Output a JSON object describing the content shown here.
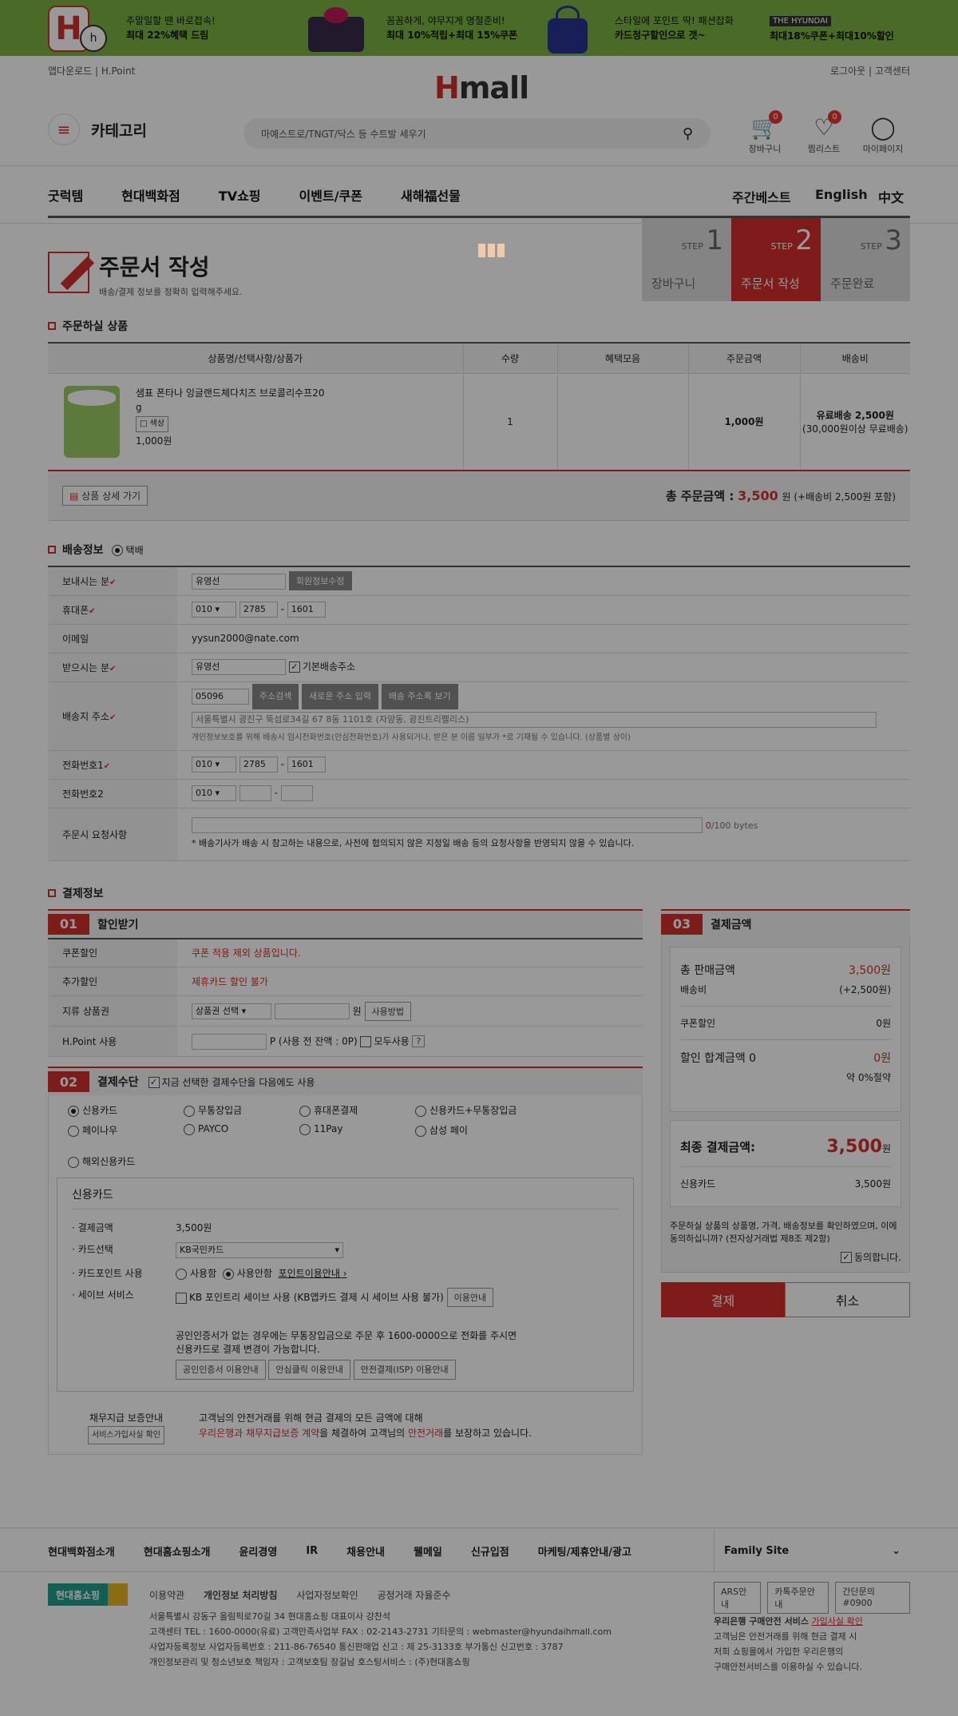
{
  "banner": [
    {
      "line1": "주말일할 땐 바로접속!",
      "line2": "최대 22%혜택 드림"
    },
    {
      "line1": "꼼꼼하게, 야무지게 명절준비!",
      "line2": "최대 10%적립+최대 15%쿠폰"
    },
    {
      "line1": "스타일에 포인트 딱! 패션잡화",
      "line2": "카드청구할인으로 갯~"
    },
    {
      "brand": "THE HYUNDAI",
      "line2": "최대18%쿠폰+최대10%할인"
    }
  ],
  "header": {
    "left_links": "앱다운로드 | H.Point",
    "right_links": "로그아웃 | 고객센터",
    "logo_h": "H",
    "logo_rest": "mall",
    "category": "카테고리",
    "search_placeholder": "마예스트로/TNGT/닥스 등 수트발 세우기",
    "cart": "장바구니",
    "cart_count": "0",
    "wish": "찜리스트",
    "wish_count": "0",
    "mypage": "마이페이지"
  },
  "gnb": {
    "items": [
      "굿럭템",
      "현대백화점",
      "TV쇼핑",
      "이벤트/쿠폰",
      "새해福선물"
    ],
    "right": [
      "주간베스트",
      "English",
      "中文"
    ]
  },
  "title": {
    "main": "주문서 작성",
    "sub": "배송/결제 정보를 정확히 입력해주세요.",
    "steps": [
      {
        "label": "장바구니",
        "n": "1"
      },
      {
        "label": "주문서 작성",
        "n": "2"
      },
      {
        "label": "주문완료",
        "n": "3"
      }
    ],
    "step_prefix": "STEP"
  },
  "products": {
    "section": "주문하실 상품",
    "headers": [
      "상품명/선택사항/상품가",
      "수량",
      "혜택모음",
      "주문금액",
      "배송비"
    ],
    "item": {
      "name": "샘표 폰타나 잉글랜드체다치즈 브로콜리수프20",
      "name2": "g",
      "option": "□ 색상",
      "price": "1,000원",
      "qty": "1",
      "amount": "1,000원",
      "ship1": "유료배송 2,500원",
      "ship2": "(30,000원이상 무료배송)"
    },
    "detail_btn": "상품 상세 가기",
    "total_label": "총 주문금액 :",
    "total_value": "3,500",
    "total_unit": "원 (+배송비 2,500원 포함)"
  },
  "delivery": {
    "section": "배송정보",
    "radio": "택배",
    "sender_label": "보내시는 분",
    "sender": "유영선",
    "sender_btn": "회원정보수정",
    "mobile_label": "휴대폰",
    "mobile": [
      "010",
      "2785",
      "1601"
    ],
    "email_label": "이메일",
    "email": "yysun2000@nate.com",
    "receiver_label": "받으시는 분",
    "receiver": "유영선",
    "default_addr": "기본배송주소",
    "addr_label": "배송지 주소",
    "zip": "05096",
    "btn_search": "주소검색",
    "btn_new": "새로운 주소 입력",
    "btn_list": "배송 주소록 보기",
    "addr": "서울특별시 광진구 뚝섬로34길 67 8동 1101호 (자양동, 광진트리펠리스)",
    "addr_note": "개인정보보호를 위해 배송시 임시전화번호(안심전화번호)가 사용되거나, 받은 분 이름 일부가 *로 기재될 수 있습니다. (상품별 상이)",
    "tel1_label": "전화번호1",
    "tel1": [
      "010",
      "2785",
      "1601"
    ],
    "tel2_label": "전화번호2",
    "tel2": [
      "010",
      "",
      ""
    ],
    "req_label": "주문시 요청사항",
    "req_bytes": "0",
    "req_max": "/100 bytes",
    "req_note": "* 배송기사가 배송 시 참고하는 내용으로, 사전에 협의되지 않은 지정일 배송 등의 요청사항을 반영되지 않을 수 있습니다."
  },
  "payment": {
    "section": "결제정보",
    "discount": {
      "num": "01",
      "title": "할인받기",
      "coupon_label": "쿠폰할인",
      "coupon": "쿠폰 적용 제외 상품입니다.",
      "extra_label": "추가할인",
      "extra": "제휴카드 할인 불가",
      "gift_label": "지류 상품권",
      "gift_select": "상품권 선택",
      "gift_unit": "원",
      "gift_btn": "사용방법",
      "hpoint_label": "H.Point 사용",
      "hpoint_unit": "P",
      "hpoint_avail": "(사용 전 잔액 : 0P)",
      "hpoint_all": "모두사용",
      "hpoint_q": "?"
    },
    "method": {
      "num": "02",
      "title": "결제수단",
      "save_chk": "지금 선택한 결제수단을 다음에도 사용",
      "options": [
        "신용카드",
        "무통장입금",
        "휴대폰결제",
        "신용카드+무통장입금",
        "페이나우",
        "PAYCO",
        "11Pay",
        "삼성 페이"
      ],
      "overseas": "해외신용카드"
    },
    "card": {
      "title": "신용카드",
      "amount_label": "결제금액",
      "amount": "3,500원",
      "select_label": "카드선택",
      "select": "KB국민카드",
      "point_label": "카드포인트 사용",
      "point_use": "사용함",
      "point_nouse": "사용안함",
      "point_link": "포인트이용안내 ›",
      "save_label": "세이브 서비스",
      "save": "KB 포인트리 세이브 사용 (KB앱카드 결제 시 세이브 사용 불가)",
      "save_btn": "이용안내",
      "note1": "공인인증서가 없는 경우에는 무통장입금으로 주문 후 1600-0000으로 전화를 주시면",
      "note2": "신용카드로 결제 변경이 가능합니다.",
      "btns": [
        "공인인증서 이용안내",
        "안심클릭 이용안내",
        "안전결제(ISP) 이용안내"
      ]
    },
    "escrow": {
      "title": "채무지급 보증안내",
      "btn": "서비스가입사실 확인",
      "line1": "고객님의 안전거래를 위해 현금 결제의 모든 금액에 대해",
      "line2a": "우리은행과 채무지급보증 계약",
      "line2b": "을 체결하여 고객님의 ",
      "line2c": "안전거래",
      "line2d": "를 보장하고 있습니다."
    },
    "summary": {
      "num": "03",
      "title": "결제금액",
      "sale_label": "총 판매금액",
      "sale": "3,500원",
      "ship_label": "배송비",
      "ship": "(+2,500원)",
      "coupon_label": "쿠폰할인",
      "coupon": "0원",
      "disc_label": "할인 합계금액 0",
      "disc": "0원",
      "disc_pct": "약 0%절약",
      "final_label": "최종 결제금액:",
      "final": "3,500",
      "final_unit": "원",
      "card_label": "신용카드",
      "card": "3,500원",
      "agree_text": "주문하실 상품의 상품명, 가격, 배송정보를 확인하였으며, 이에동의하십니까? (전자상거래법 제8조 제2항)",
      "agree": "동의합니다.",
      "pay_btn": "결제",
      "cancel_btn": "취소"
    }
  },
  "footer": {
    "links": [
      "현대백화점소개",
      "현대홈쇼핑소개",
      "윤리경영",
      "IR",
      "채용안내",
      "웰메일",
      "신규입점",
      "마케팅/제휴안내/광고"
    ],
    "family": "Family Site",
    "logo": "현대홈쇼핑",
    "sublinks": [
      "이용약관",
      "개인정보 처리방침",
      "사업자정보확인",
      "공정거래 자율준수"
    ],
    "info": [
      "서울특별시 강동구 올림픽로70길 34 현대홈쇼핑 대표이사 강찬석",
      "고객센터 TEL : 1600-0000(유료) 고객만족사업부 FAX : 02-2143-2731 기타문의 : webmaster@hyundaihmall.com",
      "사업자등록정보 사업자등록번호 : 211-86-76540 통신판매업 신고 : 제 25-3133호 부가통신 신고번호 : 3787",
      "개인정보관리 및 청소년보호 책임자 : 고객보호팀 장길남 호스팅서비스 : (주)현대홈쇼핑"
    ],
    "right_btns": [
      "ARS안내",
      "카톡주문안내",
      "간단문의#0900"
    ],
    "bank_title": "우리은행 구매안전 서비스",
    "bank_link": "가입사실 확인",
    "bank_lines": [
      "고객님은 안전거래를 위해 현금 결제 시",
      "저희 쇼핑몰에서 가입한 우리은행의",
      "구매안전서비스를 이용하실 수 있습니다."
    ]
  }
}
